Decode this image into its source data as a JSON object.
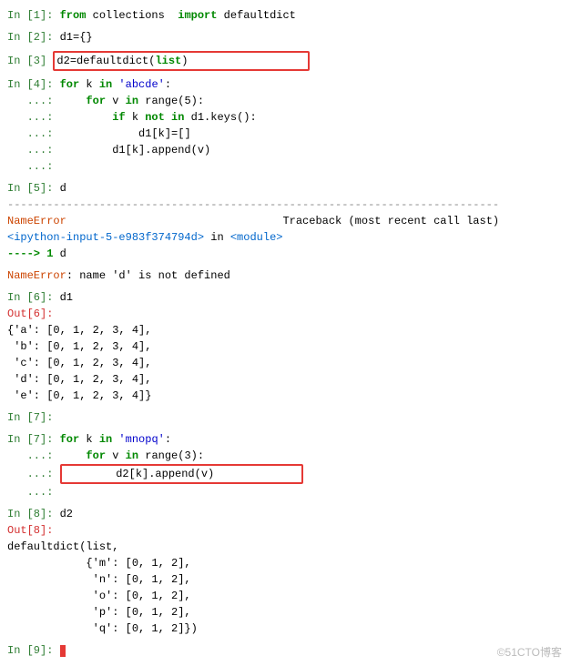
{
  "cells": {
    "in1": {
      "prompt": "In [1]: ",
      "kw_from": "from",
      "module": " collections  ",
      "kw_import": "import",
      "item": " defaultdict"
    },
    "in2": {
      "prompt": "In [2]: ",
      "code": "d1={}"
    },
    "in3": {
      "prompt": "In [3] ",
      "code_pre": "d2=defaultdict(",
      "code_arg": "list",
      "code_post": ")"
    },
    "in4": {
      "prompt": "In [4]: ",
      "l1_for": "for",
      "l1_rest": " k ",
      "l1_in": "in",
      "l1_str": " 'abcde'",
      "l1_end": ":",
      "cont": "   ...: ",
      "l2_pad": "    ",
      "l2_for": "for",
      "l2_rest": " v ",
      "l2_in": "in",
      "l2_call": " range(5):",
      "l3_pad": "        ",
      "l3_if": "if",
      "l3_rest": " k ",
      "l3_not": "not in",
      "l3_end": " d1.keys():",
      "l4_pad": "            ",
      "l4_code": "d1[k]=[]",
      "l5_pad": "        ",
      "l5_code": "d1[k].append(v)"
    },
    "in5": {
      "prompt": "In [5]: ",
      "code": "d"
    },
    "traceback": {
      "sep": "---------------------------------------------------------------------------",
      "err_name": "NameError",
      "tb_label": "                                 Traceback (most recent call last)",
      "loc_pre": "<ipython-input-5-e983f374794d>",
      "loc_mid": " in ",
      "loc_post": "<module>",
      "arrow": "----> 1 ",
      "arrow_code": "d",
      "msg_name": "NameError",
      "msg_text": ": name 'd' is not defined"
    },
    "in6": {
      "prompt": "In [6]: ",
      "code": "d1"
    },
    "out6": {
      "prompt": "Out[6]:",
      "l1": "{'a': [0, 1, 2, 3, 4],",
      "l2": " 'b': [0, 1, 2, 3, 4],",
      "l3": " 'c': [0, 1, 2, 3, 4],",
      "l4": " 'd': [0, 1, 2, 3, 4],",
      "l5": " 'e': [0, 1, 2, 3, 4]}"
    },
    "in7a": {
      "prompt": "In [7]:"
    },
    "in7": {
      "prompt": "In [7]: ",
      "l1_for": "for",
      "l1_rest": " k ",
      "l1_in": "in",
      "l1_str": " 'mnopq'",
      "l1_end": ":",
      "cont": "   ...: ",
      "l2_pad": "    ",
      "l2_for": "for",
      "l2_rest": " v ",
      "l2_in": "in",
      "l2_call": " range(3):",
      "l3_pad": "        ",
      "l3_code": "d2[k].append(v)"
    },
    "in8": {
      "prompt": "In [8]: ",
      "code": "d2"
    },
    "out8": {
      "prompt": "Out[8]:",
      "l1": "defaultdict(list,",
      "l2": "            {'m': [0, 1, 2],",
      "l3": "             'n': [0, 1, 2],",
      "l4": "             'o': [0, 1, 2],",
      "l5": "             'p': [0, 1, 2],",
      "l6": "             'q': [0, 1, 2]})"
    },
    "in9": {
      "prompt": "In [9]: "
    }
  },
  "watermark": "©51CTO博客"
}
